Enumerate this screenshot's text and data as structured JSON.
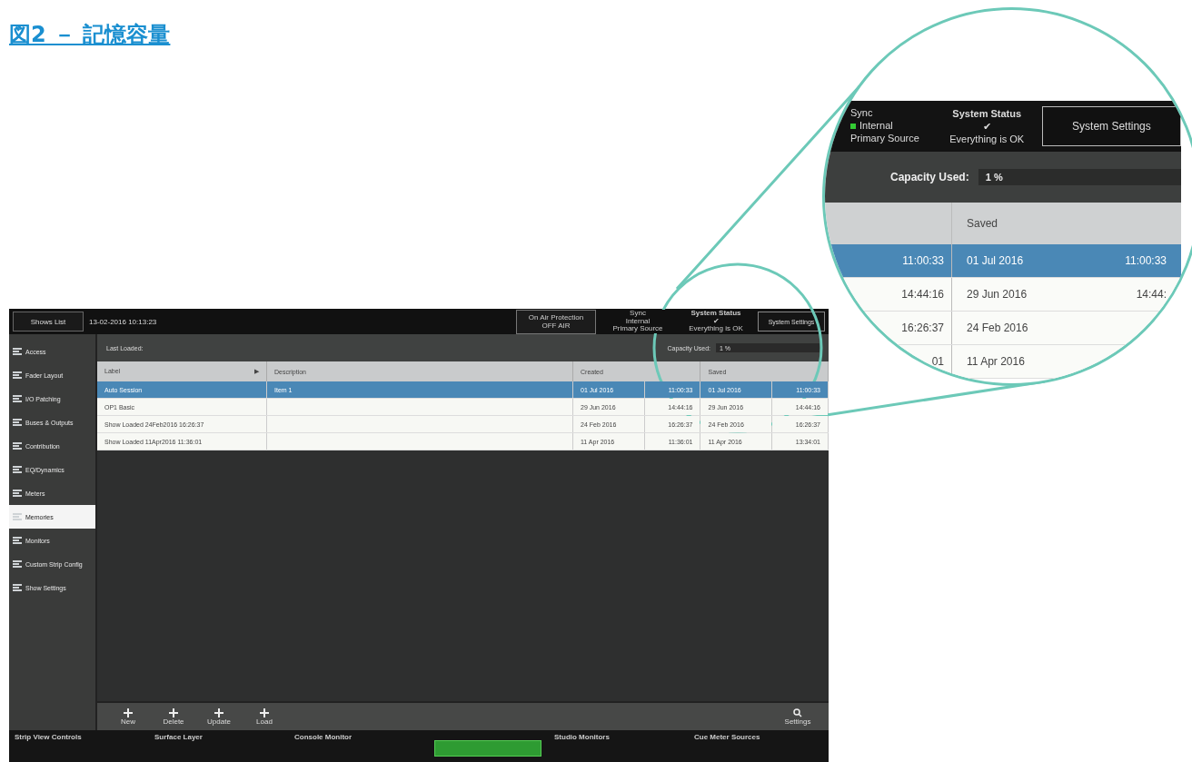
{
  "heading": "図2 － 記憶容量",
  "console": {
    "back_button": "Shows List",
    "show_time": "13-02-2016 10:13:23",
    "on_air": {
      "label": "On Air Protection",
      "value": "OFF AIR"
    },
    "sync": {
      "label": "Sync",
      "source": "Internal",
      "detail": "Primary Source"
    },
    "system_status": {
      "label": "System Status",
      "mark": "✔",
      "message": "Everything is OK"
    },
    "system_settings_button": "System Settings",
    "sidebar": [
      {
        "label": "Access",
        "selected": false
      },
      {
        "label": "Fader Layout",
        "selected": false
      },
      {
        "label": "I/O Patching",
        "selected": false
      },
      {
        "label": "Buses & Outputs",
        "selected": false
      },
      {
        "label": "Contribution",
        "selected": false
      },
      {
        "label": "EQ/Dynamics",
        "selected": false
      },
      {
        "label": "Meters",
        "selected": false
      },
      {
        "label": "Memories",
        "selected": true
      },
      {
        "label": "Monitors",
        "selected": false
      },
      {
        "label": "Custom Strip Config",
        "selected": false
      },
      {
        "label": "Show Settings",
        "selected": false
      }
    ],
    "last_loaded_label": "Last Loaded:",
    "capacity": {
      "label": "Capacity Used:",
      "value": "1 %"
    },
    "table": {
      "columns": [
        "Label",
        "Description",
        "Created",
        "Saved"
      ],
      "sort_mark": "▶",
      "rows": [
        {
          "label": "Auto Session",
          "description": "Item 1",
          "created_date": "01 Jul 2016",
          "created_time": "11:00:33",
          "saved_date": "01 Jul 2016",
          "saved_time": "11:00:33",
          "selected": true
        },
        {
          "label": "OP1 Basic",
          "created_date": "29 Jun 2016",
          "created_time": "14:44:16",
          "saved_date": "29 Jun 2016",
          "saved_time": "14:44:16",
          "selected": false
        },
        {
          "label": "Show Loaded 24Feb2016 16:26:37",
          "created_date": "24 Feb 2016",
          "created_time": "16:26:37",
          "saved_date": "24 Feb 2016",
          "saved_time": "16:26:37",
          "selected": false
        },
        {
          "label": "Show Loaded 11Apr2016 11:36:01",
          "created_date": "11 Apr 2016",
          "created_time": "11:36:01",
          "saved_date": "11 Apr 2016",
          "saved_time": "13:34:01",
          "selected": false
        }
      ]
    },
    "toolbar": [
      "New",
      "Delete",
      "Update",
      "Load"
    ],
    "settings_button": "Settings",
    "bottom_panels": [
      "Strip View Controls",
      "Surface Layer",
      "Console Monitor",
      "Studio Monitors",
      "Cue Meter Sources"
    ]
  },
  "magnifier": {
    "sync": {
      "label": "Sync",
      "source": "Internal",
      "detail": "Primary Source"
    },
    "system_status": {
      "label": "System Status",
      "mark": "✔",
      "message": "Everything is OK"
    },
    "system_settings_button": "System Settings",
    "capacity": {
      "label": "Capacity Used:",
      "value": "1 %"
    },
    "column": "Saved",
    "rows": [
      {
        "time_left": "11:00:33",
        "saved_date": "01 Jul 2016",
        "saved_time": "11:00:33",
        "selected": true
      },
      {
        "time_left": "14:44:16",
        "saved_date": "29 Jun 2016",
        "saved_time": "14:44:",
        "selected": false
      },
      {
        "time_left": "16:26:37",
        "saved_date": "24 Feb 2016",
        "selected": false
      },
      {
        "time_left": "01",
        "saved_date": "11 Apr 2016",
        "selected": false
      }
    ]
  }
}
